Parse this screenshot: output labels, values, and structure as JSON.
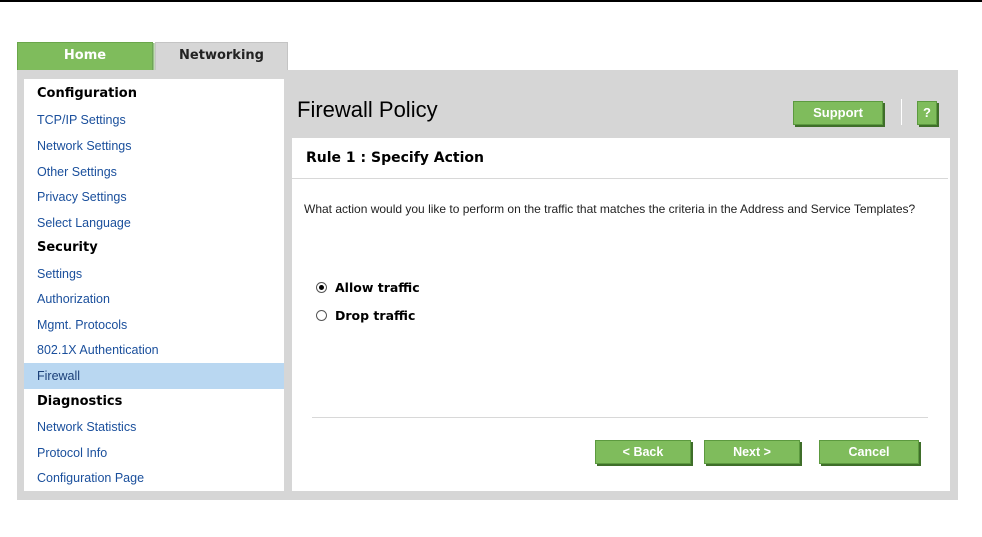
{
  "tabs": {
    "home": "Home",
    "networking": "Networking"
  },
  "sidebar": {
    "items": [
      {
        "label": "Configuration",
        "type": "heading"
      },
      {
        "label": "TCP/IP Settings",
        "type": "link"
      },
      {
        "label": "Network Settings",
        "type": "link"
      },
      {
        "label": "Other Settings",
        "type": "link"
      },
      {
        "label": "Privacy Settings",
        "type": "link"
      },
      {
        "label": "Select Language",
        "type": "link"
      },
      {
        "label": "Security",
        "type": "heading"
      },
      {
        "label": "Settings",
        "type": "link"
      },
      {
        "label": "Authorization",
        "type": "link"
      },
      {
        "label": "Mgmt. Protocols",
        "type": "link"
      },
      {
        "label": "802.1X Authentication",
        "type": "link"
      },
      {
        "label": "Firewall",
        "type": "link",
        "active": true
      },
      {
        "label": "Diagnostics",
        "type": "heading"
      },
      {
        "label": "Network Statistics",
        "type": "link"
      },
      {
        "label": "Protocol Info",
        "type": "link"
      },
      {
        "label": "Configuration Page",
        "type": "link"
      }
    ]
  },
  "header": {
    "title": "Firewall Policy",
    "support_label": "Support",
    "help_label": "?"
  },
  "panel": {
    "rule_title": "Rule 1 : Specify Action",
    "question": "What action would you like to perform on the traffic that matches the criteria in the Address and Service Templates?",
    "options": [
      {
        "label": "Allow traffic",
        "selected": true
      },
      {
        "label": "Drop traffic",
        "selected": false
      }
    ]
  },
  "buttons": {
    "back": "< Back",
    "next": "Next >",
    "cancel": "Cancel"
  },
  "colors": {
    "accent_green": "#7fbc5c",
    "frame_grey": "#d6d6d6",
    "link_blue": "#1a4f9c",
    "active_row": "#b9d7f1"
  }
}
